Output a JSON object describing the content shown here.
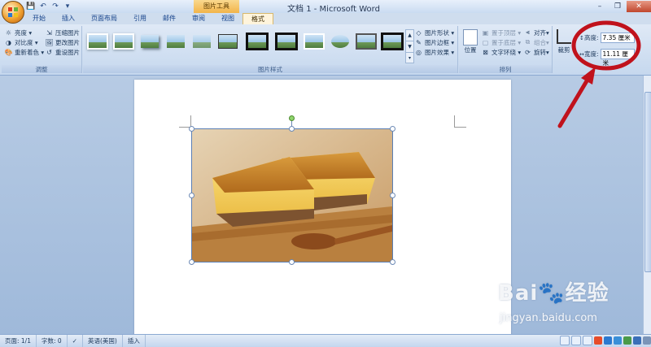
{
  "titlebar": {
    "contextual_tab": "图片工具",
    "window_title": "文档 1 - Microsoft Word",
    "controls": {
      "minimize": "–",
      "restore": "❐",
      "close": "✕"
    }
  },
  "tabs": [
    "开始",
    "插入",
    "页面布局",
    "引用",
    "邮件",
    "审阅",
    "视图",
    "格式"
  ],
  "active_tab": "格式",
  "ribbon": {
    "adjust": {
      "label": "调整",
      "brightness": "亮度",
      "contrast": "对比度",
      "recolor": "重新着色",
      "compress": "压缩图片",
      "change_picture": "更改图片",
      "reset_picture": "重设图片"
    },
    "picture_styles": {
      "label": "图片样式",
      "shape": "图片形状",
      "border": "图片边框",
      "effects": "图片效果"
    },
    "arrange": {
      "label": "排列",
      "position": "位置",
      "bring_front": "置于顶层",
      "send_back": "置于底层",
      "text_wrap": "文字环绕",
      "align": "对齐",
      "group": "组合",
      "rotate": "旋转"
    },
    "size": {
      "crop": "裁剪",
      "height_label": "高度:",
      "height_value": "7.35 厘米",
      "width_label": "宽度:",
      "width_value": "11.11 厘米"
    }
  },
  "statusbar": {
    "page": "页面: 1/1",
    "words": "字数: 0",
    "language": "英语(美国)",
    "mode": "插入"
  },
  "watermark": {
    "logo": "Bai🐾经验",
    "url": "jingyan.baidu.com"
  },
  "colors": {
    "annotation": "#c0121c",
    "title_bar": "#c9dbf1",
    "ribbon": "#dfe9f6"
  }
}
